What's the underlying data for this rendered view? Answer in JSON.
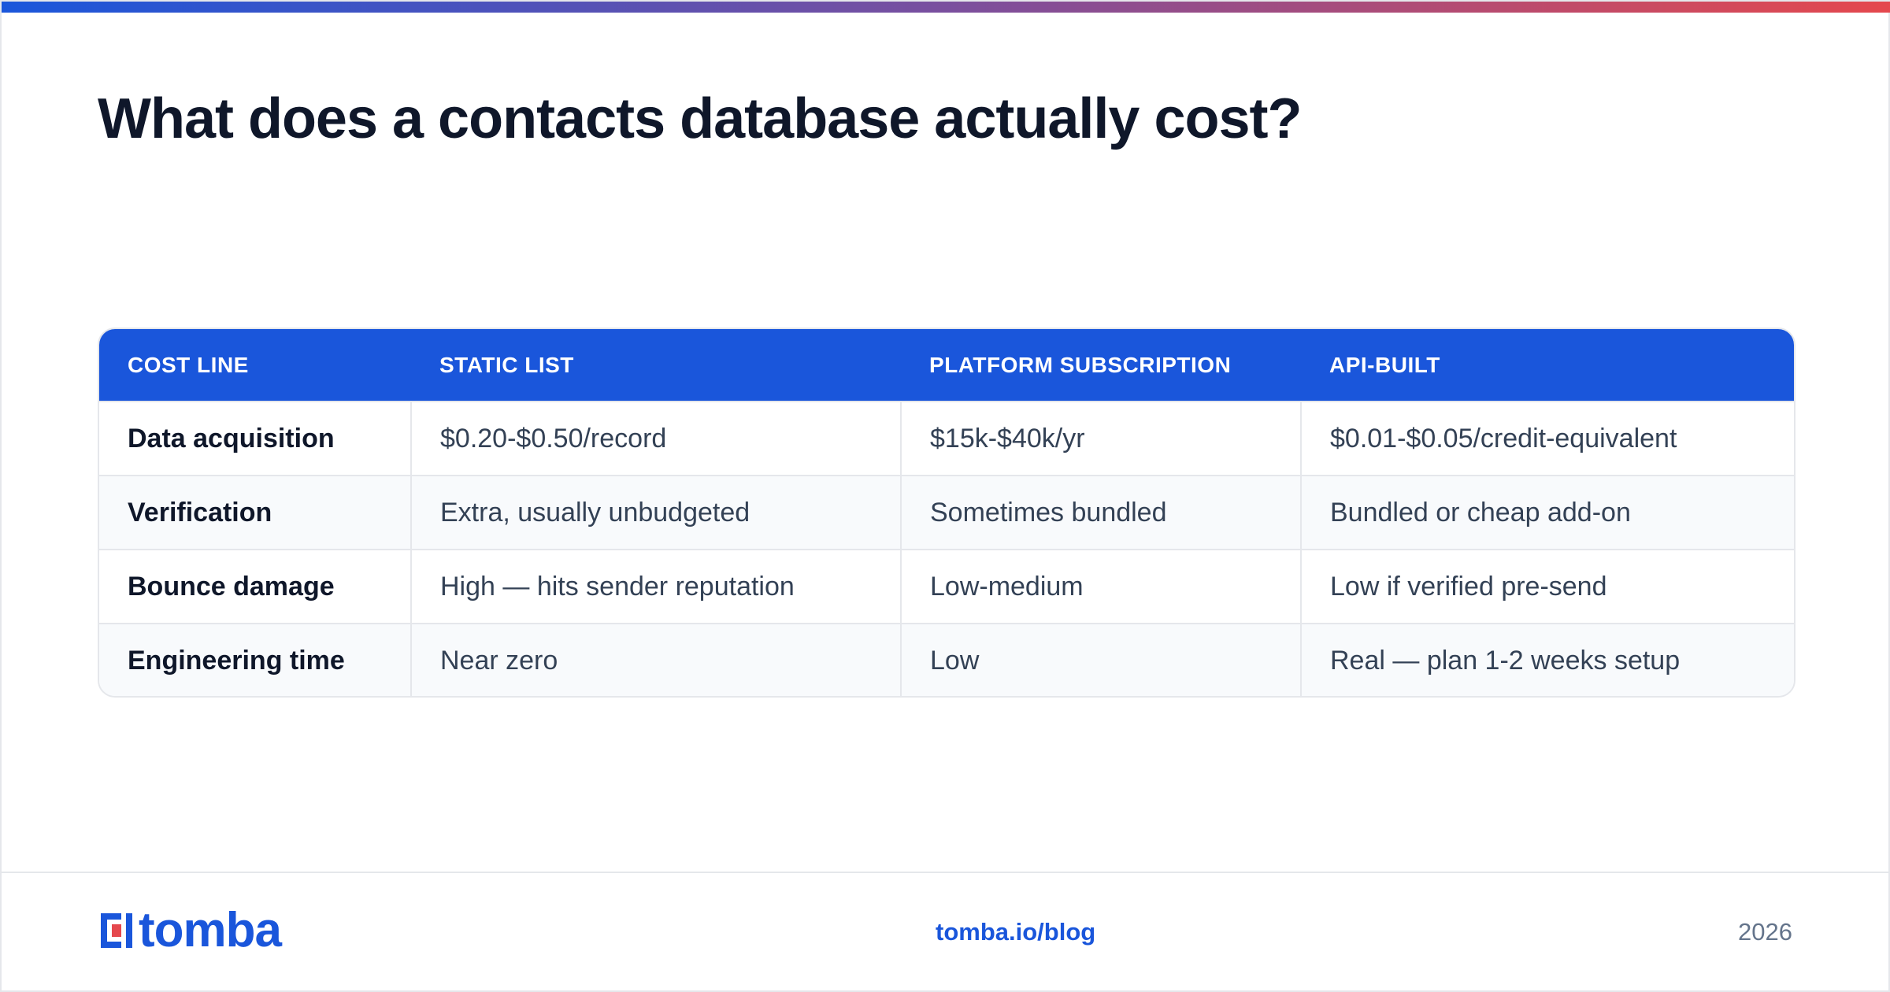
{
  "header": {
    "title": "What does a contacts database actually cost?"
  },
  "table": {
    "columns": [
      "COST LINE",
      "STATIC LIST",
      "PLATFORM SUBSCRIPTION",
      "API-BUILT"
    ],
    "rows": [
      [
        "Data acquisition",
        "$0.20-$0.50/record",
        "$15k-$40k/yr",
        "$0.01-$0.05/credit-equivalent"
      ],
      [
        "Verification",
        "Extra, usually unbudgeted",
        "Sometimes bundled",
        "Bundled or cheap add-on"
      ],
      [
        "Bounce damage",
        "High — hits sender reputation",
        "Low-medium",
        "Low if verified pre-send"
      ],
      [
        "Engineering time",
        "Near zero",
        "Low",
        "Real — plan 1-2 weeks setup"
      ]
    ]
  },
  "footer": {
    "logo_text": "tomba",
    "link": "tomba.io/blog",
    "year": "2026"
  },
  "colors": {
    "accent": "#1a56db",
    "logo_red": "#e5484d",
    "title": "#0f172a",
    "body_text": "#334155"
  }
}
